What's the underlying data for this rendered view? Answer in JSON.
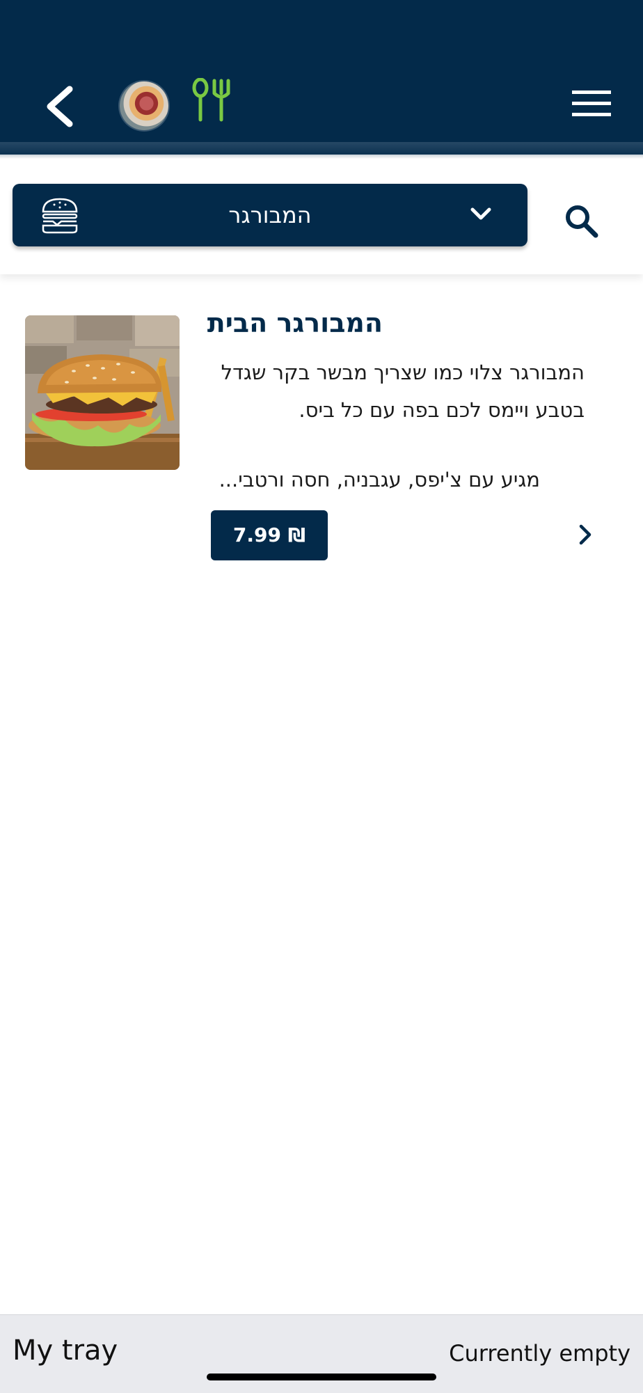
{
  "header": {
    "back_icon": "chevron-left-icon",
    "restaurant_avatar": "restaurant-avatar",
    "utensils_icon": "spoon-fork-icon",
    "menu_icon": "hamburger-menu-icon"
  },
  "filter": {
    "category_label": "המבורגר",
    "category_icon": "burger-icon",
    "dropdown_icon": "chevron-down-icon",
    "search_icon": "search-icon"
  },
  "products": [
    {
      "title": "המבורגר הבית",
      "description_line1": "המבורגר צלוי כמו שצריך מבשר בקר שגדל",
      "description_line2": "בטבע ויימס לכם בפה עם כל ביס.",
      "description_extra": "מגיע עם צ'יפס, עגבניה, חסה ורטבי...",
      "price": "7.99 ₪"
    }
  ],
  "tray": {
    "title": "My tray",
    "status": "Currently empty"
  },
  "colors": {
    "primary": "#032a4a",
    "accent_green": "#7ac943",
    "tray_bg": "#e9eaee"
  }
}
